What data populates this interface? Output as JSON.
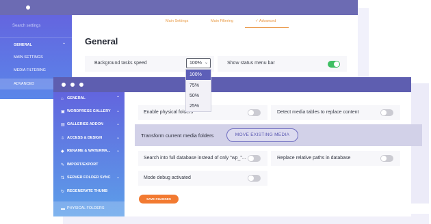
{
  "back_window": {
    "sidebar": {
      "search_placeholder": "Search settings",
      "group_label": "GENERAL",
      "items": [
        {
          "label": "MAIN SETTINGS"
        },
        {
          "label": "MEDIA FILTERING"
        },
        {
          "label": "ADVANCED"
        }
      ]
    },
    "tabs": [
      {
        "label": "Main Settings"
      },
      {
        "label": "Main Filtering"
      },
      {
        "label": "✓ Advanced"
      }
    ],
    "page_title": "General",
    "background_speed": {
      "label": "Background tasks speed",
      "value": "100%",
      "options": [
        "100%",
        "75%",
        "50%",
        "25%"
      ],
      "selected_index": 0
    },
    "status_bar": {
      "label": "Show status menu bar",
      "enabled": true
    }
  },
  "front_window": {
    "sidebar": {
      "items": [
        {
          "label": "GENERAL",
          "icon": "home-icon",
          "chevron": true,
          "active": false
        },
        {
          "label": "WORDPRESS GALLERY",
          "icon": "image-icon",
          "chevron": true,
          "active": false
        },
        {
          "label": "GALLERIES ADDON",
          "icon": "gallery-icon",
          "chevron": true,
          "active": false
        },
        {
          "label": "ACCESS & DESIGN",
          "icon": "download-icon",
          "chevron": true,
          "active": false
        },
        {
          "label": "RENAME & WATERMA...",
          "icon": "tag-icon",
          "chevron": true,
          "active": false
        },
        {
          "label": "IMPORT/EXPORT",
          "icon": "wrench-icon",
          "chevron": false,
          "active": false
        },
        {
          "label": "SERVER FOLDER SYNC",
          "icon": "sync-icon",
          "chevron": true,
          "active": false
        },
        {
          "label": "REGENERATE THUMB",
          "icon": "refresh-icon",
          "chevron": false,
          "active": false
        },
        {
          "label": "PHYSICAL FOLDERS",
          "icon": "folder-icon",
          "chevron": false,
          "active": true
        }
      ]
    },
    "options": {
      "enable_physical_folders": {
        "label": "Enable physical folders",
        "enabled": false
      },
      "detect_media_tables": {
        "label": "Detect media tables to replace content",
        "enabled": false
      },
      "search_full_db": {
        "label": "Search into full database instead of only \"wp_\"...",
        "enabled": false
      },
      "replace_relative_paths": {
        "label": "Replace relative paths in database",
        "enabled": false
      },
      "mode_debug": {
        "label": "Mode debug activated",
        "enabled": false
      }
    },
    "transform": {
      "label": "Transform current media folders",
      "button_label": "MOVE EXISTING MEDIA"
    },
    "save_label": "SAVE CHANGES"
  },
  "colors": {
    "accent_orange": "#f27a31",
    "toggle_on": "#3fbf63",
    "toggle_off": "#cbcbd2",
    "header_purple": "#5e5eb0"
  }
}
